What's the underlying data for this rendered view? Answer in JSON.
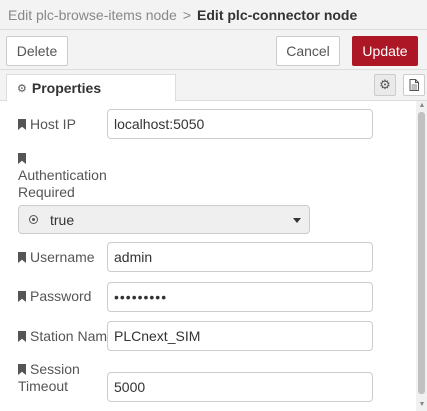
{
  "breadcrumb": {
    "parent": "Edit plc-browse-items node",
    "separator": ">",
    "current": "Edit plc-connector node"
  },
  "toolbar": {
    "delete_label": "Delete",
    "cancel_label": "Cancel",
    "update_label": "Update"
  },
  "tabs": {
    "properties_label": "Properties",
    "properties_icon": "gear-icon",
    "settings_icon": "gear-icon",
    "description_icon": "document-icon"
  },
  "colors": {
    "accent": "#ad1625",
    "toolbar_bg": "#f3f3f3",
    "select_bg": "#efefef"
  },
  "form": {
    "host_ip": {
      "label": "Host IP",
      "value": "localhost:5050"
    },
    "auth_required": {
      "label_line1": "Authentication",
      "label_line2": "Required",
      "selected": "true"
    },
    "username": {
      "label": "Username",
      "value": "admin"
    },
    "password": {
      "label": "Password",
      "value": "•••••••••"
    },
    "station_name": {
      "label": "Station Name",
      "value": "PLCnext_SIM"
    },
    "session_timeout": {
      "label_line1": "Session",
      "label_line2": "Timeout",
      "value": "5000"
    }
  }
}
